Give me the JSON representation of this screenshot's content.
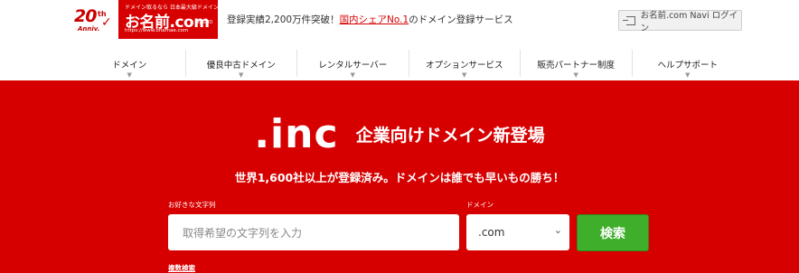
{
  "header": {
    "anniversary": {
      "number": "20",
      "suffix": "th",
      "text": "Anniv."
    },
    "logo": {
      "tagline": "ドメイン取るなら 日本最大級ドメイン",
      "name": "お名前.com",
      "url": "https://www.onamae.com",
      "gmo": "byGMO"
    },
    "tagline": {
      "prefix": "登録実績2,200万件突破！",
      "highlight": "国内シェアNo.1",
      "suffix": "のドメイン登録サービス"
    },
    "login_button": "お名前.com Navi ログイン"
  },
  "nav": {
    "items": [
      {
        "label": "ドメイン"
      },
      {
        "label": "優良中古ドメイン"
      },
      {
        "label": "レンタルサーバー"
      },
      {
        "label": "オプションサービス"
      },
      {
        "label": "販売パートナー制度"
      },
      {
        "label": "ヘルプサポート"
      }
    ]
  },
  "hero": {
    "tld": ".inc",
    "headline": "企業向けドメイン新登場",
    "subheadline": "世界1,600社以上が登録済み。ドメインは誰でも早いもの勝ち！"
  },
  "search": {
    "keyword_label": "お好きな文字列",
    "keyword_placeholder": "取得希望の文字列を入力",
    "domain_label": "ドメイン",
    "domain_selected": ".com",
    "submit_label": "検索",
    "bulk_link": "複数検索"
  },
  "colors": {
    "brand_red": "#d70000",
    "search_green": "#3fae2a"
  }
}
